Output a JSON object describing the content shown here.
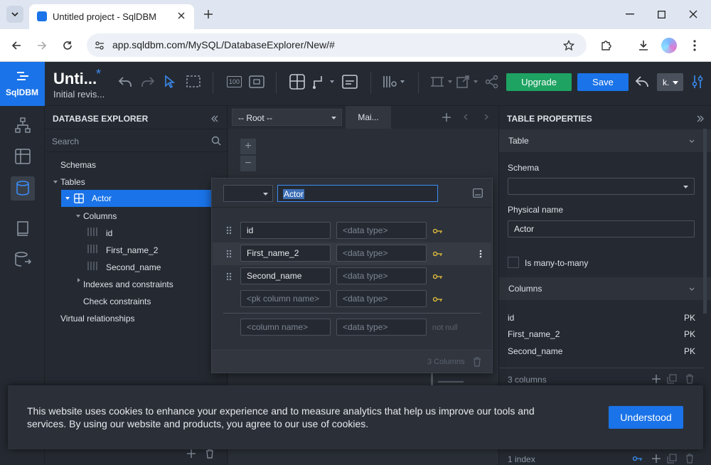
{
  "browser": {
    "tab_title": "Untitled project - SqlDBM",
    "url": "app.sqldbm.com/MySQL/DatabaseExplorer/New/#"
  },
  "app": {
    "logo_text": "SqlDBM",
    "project_title": "Unti...",
    "project_modified": "*",
    "revision": "Initial revis...",
    "upgrade_label": "Upgrade",
    "save_label": "Save",
    "user_initial": "k.",
    "zoom_label": "100"
  },
  "explorer": {
    "title": "DATABASE EXPLORER",
    "search_placeholder": "Search",
    "schemas": "Schemas",
    "tables": "Tables",
    "actor": "Actor",
    "columns": "Columns",
    "col1": "id",
    "col2": "First_name_2",
    "col3": "Second_name",
    "indexes": "Indexes and constraints",
    "check": "Check constraints",
    "virtual": "Virtual relationships"
  },
  "canvas": {
    "root_select": "-- Root --",
    "main_tab": "Mai...",
    "zoom_in": "+",
    "zoom_out": "−"
  },
  "editor": {
    "table_name": "Actor",
    "rows": [
      {
        "name": "id",
        "type_placeholder": "<data type>"
      },
      {
        "name": "First_name_2",
        "type_placeholder": "<data type>"
      },
      {
        "name": "Second_name",
        "type_placeholder": "<data type>"
      }
    ],
    "pk_placeholder": "<pk column name>",
    "pk_type_placeholder": "<data type>",
    "new_col_placeholder": "<column name>",
    "new_type_placeholder": "<data type>",
    "not_null": "not null",
    "footer_count": "3 Columns"
  },
  "properties": {
    "title": "TABLE PROPERTIES",
    "table_section": "Table",
    "schema_label": "Schema",
    "physical_label": "Physical name",
    "physical_value": "Actor",
    "many_to_many": "Is many-to-many",
    "columns_section": "Columns",
    "columns": [
      {
        "name": "id",
        "key": "PK"
      },
      {
        "name": "First_name_2",
        "key": "PK"
      },
      {
        "name": "Second_name",
        "key": "PK"
      }
    ],
    "columns_count": "3 columns",
    "index_count": "1 index"
  },
  "cookie": {
    "text": "This website uses cookies to enhance your experience and to measure analytics that help us improve our tools and services. By using our website and products, you agree to our use of cookies.",
    "button": "Understood"
  },
  "colors": {
    "accent": "#1a73e8",
    "upgrade": "#1ea362",
    "key": "#e8c23a",
    "selected": "#1a73e8"
  }
}
